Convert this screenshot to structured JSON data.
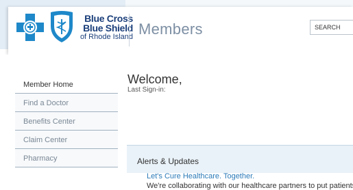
{
  "brand": {
    "line1": "Blue Cross",
    "line2": "Blue Shield",
    "line3": "of Rhode Island",
    "primary_color": "#1a3e7a",
    "cross_color": "#1e88c9"
  },
  "header": {
    "section_title": "Members",
    "search_placeholder": "SEARCH"
  },
  "sidebar": {
    "items": [
      {
        "label": "Member Home"
      },
      {
        "label": "Find a Doctor"
      },
      {
        "label": "Benefits Center"
      },
      {
        "label": "Claim Center"
      },
      {
        "label": "Pharmacy"
      }
    ]
  },
  "main": {
    "welcome": "Welcome,",
    "last_signin": "Last Sign-in:",
    "alerts": {
      "title": "Alerts & Updates",
      "link": "Let's Cure Healthcare. Together.",
      "text": "We're collaborating with our healthcare partners to put patients"
    }
  }
}
